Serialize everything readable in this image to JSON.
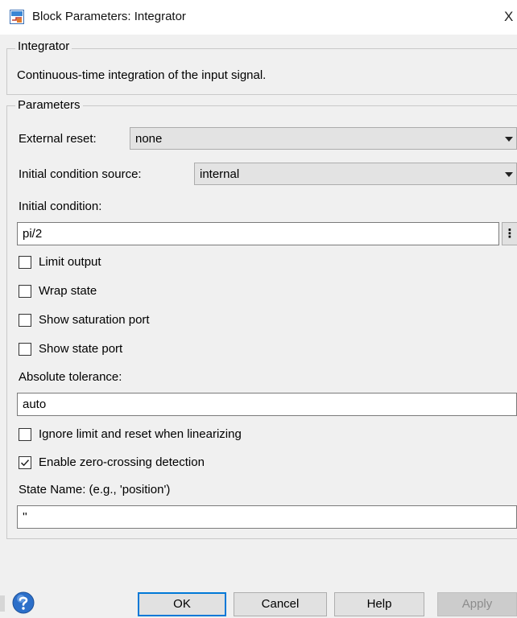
{
  "window": {
    "title": "Block Parameters: Integrator",
    "close_glyph": "X"
  },
  "block_group": {
    "legend": "Integrator",
    "description": "Continuous-time integration of the input signal."
  },
  "params_group": {
    "legend": "Parameters",
    "external_reset": {
      "label": "External reset:",
      "value": "none"
    },
    "ic_source": {
      "label": "Initial condition source:",
      "value": "internal"
    },
    "initial_condition": {
      "label": "Initial condition:",
      "value": "pi/2",
      "more_button": "⋮"
    },
    "checkboxes": [
      {
        "label": "Limit output",
        "checked": false
      },
      {
        "label": "Wrap state",
        "checked": false
      },
      {
        "label": "Show saturation port",
        "checked": false
      },
      {
        "label": "Show state port",
        "checked": false
      }
    ],
    "absolute_tolerance": {
      "label": "Absolute tolerance:",
      "value": "auto"
    },
    "ignore_limit": {
      "label": "Ignore limit and reset when linearizing",
      "checked": false
    },
    "zero_crossing": {
      "label": "Enable zero-crossing detection",
      "checked": true
    },
    "state_name": {
      "label": "State Name: (e.g., 'position')",
      "value": "''"
    }
  },
  "buttons": {
    "ok": "OK",
    "cancel": "Cancel",
    "help": "Help",
    "apply": "Apply"
  },
  "icons": {
    "app": "simulink-block-icon",
    "help": "help-icon",
    "check": "checkmark-icon"
  },
  "colors": {
    "ok_border": "#0078d7",
    "help_icon": "#2c6fc9"
  }
}
